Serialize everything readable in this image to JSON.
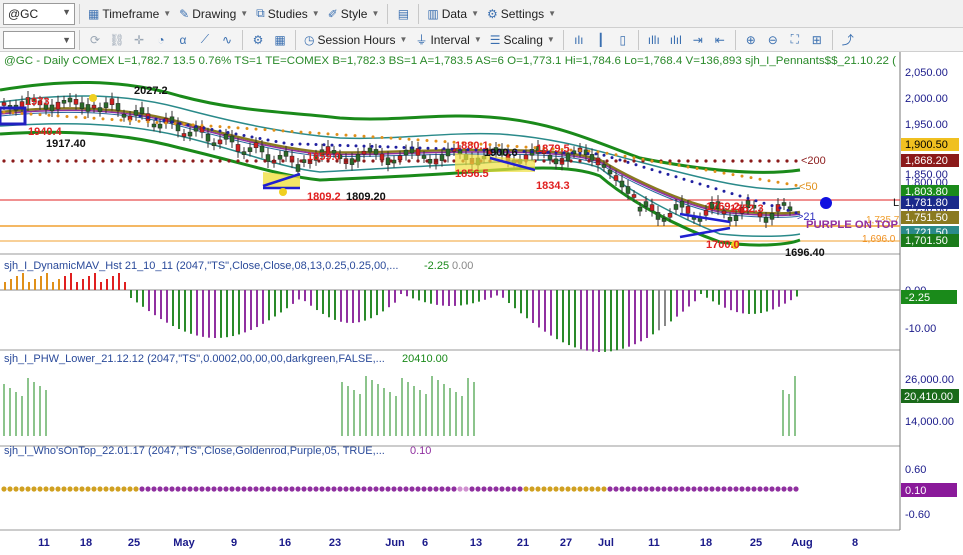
{
  "toolbar": {
    "symbol": "@GC",
    "timeframe": "Timeframe",
    "drawing": "Drawing",
    "studies": "Studies",
    "style": "Style",
    "data": "Data",
    "settings": "Settings",
    "session_hours": "Session Hours",
    "interval": "Interval",
    "scaling": "Scaling"
  },
  "chart": {
    "header": "@GC - Daily  COMEX  L=1,782.7  13.5  0.76%  TS=1  TE=COMEX  B=1,782.3  BS=1  A=1,783.5  AS=6  O=1,773.1  Hi=1,784.6  Lo=1,768.4  V=136,893  sjh_I_Pennants$$_21.10.22 (",
    "price_ticks": [
      "2,050.00",
      "2,000.00",
      "1,950.00",
      "1,850.00",
      "1,800.00",
      "1,750.00",
      "1,700.00"
    ],
    "price_tags": [
      {
        "text": "1,900.50",
        "bg": "#f0c020",
        "fg": "#000000"
      },
      {
        "text": "1,868.20",
        "bg": "#8b1a1a",
        "fg": "#ffffff"
      },
      {
        "text": "1,803.80",
        "bg": "#1a8a1a",
        "fg": "#ffffff"
      },
      {
        "text": "1,781.80",
        "bg": "#1a2a8a",
        "fg": "#ffffff"
      },
      {
        "text": "1,751.50",
        "bg": "#8a7a20",
        "fg": "#ffffff"
      },
      {
        "text": "1,721.50",
        "bg": "#2a8a8a",
        "fg": "#ffffff"
      },
      {
        "text": "1,701.50",
        "bg": "#1a7a1a",
        "fg": "#ffffff"
      }
    ],
    "annotations": {
      "p1973": "1973",
      "p1940": "1940.4",
      "p1917": "1917.40",
      "p2027": "2027.2",
      "p1859": "1859.0",
      "p1809": "1809.2",
      "p1809b": "1809.20",
      "p1880": "1880.1",
      "p1900": "1900.6",
      "p1856": "1856.5",
      "p1879": "1879.5",
      "p1834": "1834.3",
      "p1769": "1769.2",
      "p1752": "1752.3",
      "p1700": "1700.0",
      "p1696": "1696.40",
      "p1696tag": "1,696.0",
      "p1735": "1,735.7",
      "lt200": "<200",
      "lt50": "<50",
      "lt21": ">21",
      "purple": "PURPLE ON TOP",
      "l": "L"
    },
    "x_labels": [
      "11",
      "18",
      "25",
      "May",
      "9",
      "16",
      "23",
      "Jun",
      "6",
      "13",
      "21",
      "27",
      "Jul",
      "11",
      "18",
      "25",
      "Aug",
      "8"
    ]
  },
  "panel2": {
    "title": "sjh_I_DynamicMAV_Hst 21_10_11 (2047,\"TS\",Close,Close,08,13,0.25,0.25,00,...",
    "v1": "-2.25",
    "v2": "0.00",
    "ticks": [
      "0.00",
      "-10.00"
    ],
    "tag": "-2.25"
  },
  "panel3": {
    "title": "sjh_I_PHW_Lower_21.12.12 (2047,\"TS\",0.0002,00,00,00,darkgreen,FALSE,...",
    "v1": "20410.00",
    "ticks": [
      "26,000.00",
      "14,000.00"
    ],
    "tag": "20,410.00"
  },
  "panel4": {
    "title": "sjh_I_Who'sOnTop_22.01.17 (2047,\"TS\",Close,Goldenrod,Purple,05, TRUE,...",
    "v1": "0.10",
    "ticks": [
      "0.60",
      "-0.60"
    ],
    "tag": "0.10"
  }
}
